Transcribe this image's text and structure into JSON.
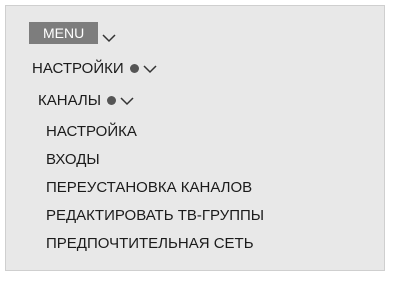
{
  "menu": {
    "label": "MENU"
  },
  "path": [
    {
      "label": "НАСТРОЙКИ"
    },
    {
      "label": "КАНАЛЫ"
    }
  ],
  "items": [
    {
      "label": "НАСТРОЙКА"
    },
    {
      "label": "ВХОДЫ"
    },
    {
      "label": "ПЕРЕУСТАНОВКА КАНАЛОВ"
    },
    {
      "label": "РЕДАКТИРОВАТЬ ТВ-ГРУППЫ"
    },
    {
      "label": "ПРЕДПОЧТИТЕЛЬНАЯ СЕТЬ"
    }
  ],
  "icons": {
    "expand": "chevron-down-icon",
    "active": "dot-indicator-icon"
  }
}
